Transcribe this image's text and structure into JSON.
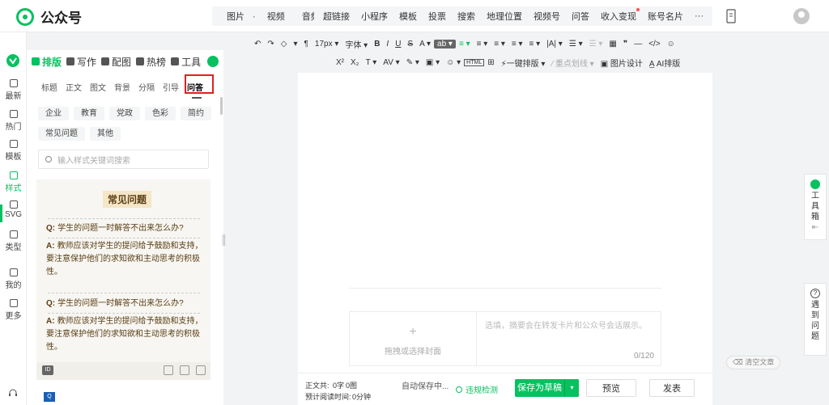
{
  "header": {
    "logo_text": "公众号",
    "insert_menu": [
      {
        "label": "图片",
        "dropdown": true
      },
      {
        "label": "视频"
      },
      {
        "label": "音频",
        "dropdown": true
      }
    ],
    "insert_menu2": [
      {
        "label": "超链接"
      },
      {
        "label": "小程序"
      },
      {
        "label": "模板"
      },
      {
        "label": "投票"
      },
      {
        "label": "搜索"
      },
      {
        "label": "地理位置"
      },
      {
        "label": "视频号"
      },
      {
        "label": "问答"
      },
      {
        "label": "收入变现",
        "dot": true
      },
      {
        "label": "账号名片"
      },
      {
        "label": "···"
      }
    ]
  },
  "toolbar": {
    "row1": [
      "↶",
      "↷",
      "◇",
      "▾",
      "¶",
      "17px ▾",
      "字体 ▾",
      "B",
      "I",
      "U",
      "S",
      "A ▾",
      "ab ▾",
      "≡ ▾",
      "≡ ▾",
      "≡ ▾",
      "≡ ▾",
      "≡ ▾",
      "|A| ▾",
      "☰ ▾",
      "☰ ▾",
      "▦",
      "❞",
      "—",
      "</>",
      "☺"
    ],
    "row2": [
      "X²",
      "X₂",
      "T ▾",
      "AV ▾",
      "✎ ▾",
      "▣ ▾",
      "☺ ▾",
      "HTML",
      "⊞",
      "⚡一键排版 ▾",
      "⁄ 重点划线 ▾",
      "▣ 图片设计",
      "A̲ AI排版"
    ]
  },
  "left_rail": [
    {
      "label": "最新"
    },
    {
      "label": "热门"
    },
    {
      "label": "模板"
    },
    {
      "label": "样式",
      "active": true
    },
    {
      "label": "SVG"
    },
    {
      "label": "类型"
    },
    {
      "label": "我的"
    },
    {
      "label": "更多"
    }
  ],
  "panel": {
    "tabs": [
      {
        "label": "排版",
        "active": true
      },
      {
        "label": "写作"
      },
      {
        "label": "配图"
      },
      {
        "label": "热榜"
      },
      {
        "label": "工具"
      }
    ],
    "style_tabs": [
      {
        "label": "标题"
      },
      {
        "label": "正文"
      },
      {
        "label": "图文"
      },
      {
        "label": "背景"
      },
      {
        "label": "分隔"
      },
      {
        "label": "引导"
      },
      {
        "label": "问答",
        "active": true
      }
    ],
    "chips": [
      "企业",
      "教育",
      "党政",
      "色彩",
      "简约",
      "常见问题",
      "其他"
    ],
    "search_placeholder": "输入样式关键词搜索",
    "card": {
      "title": "常见问题",
      "items": [
        {
          "q_key": "Q:",
          "q": "学生的问题一时解答不出来怎么办?",
          "a_key": "A:",
          "a": "教师应该对学生的提问给予鼓励和支持，要注意保护他们的求知欲和主动思考的积极性。"
        },
        {
          "q_key": "Q:",
          "q": "学生的问题一时解答不出来怎么办?",
          "a_key": "A:",
          "a": "教师应该对学生的提问给予鼓励和支持，要注意保护他们的求知欲和主动思考的积极性。"
        }
      ],
      "id_badge": "ID"
    },
    "peek_badge": "Q"
  },
  "editor": {
    "cover_hint": "拖拽或选择封面",
    "summary_placeholder": "选填，摘要会在转发卡片和公众号会话展示。",
    "summary_count": "0/120"
  },
  "bottom": {
    "stat_line1": "正文共:",
    "word_count": "0字",
    "image_count": "0图",
    "stat_line2": "预计阅读时间:",
    "read_time": "0分钟",
    "autosave": "自动保存中...",
    "violation_check": "违规检测",
    "save_draft": "保存为草稿",
    "preview": "预览",
    "publish": "发表"
  },
  "right": {
    "clear_text": "清空文章",
    "toolbox": "工具箱",
    "help": "遇到问题"
  }
}
